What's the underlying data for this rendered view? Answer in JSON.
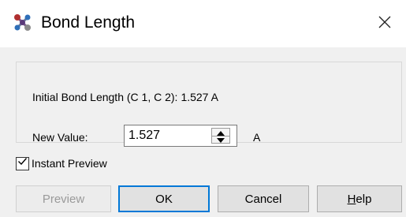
{
  "window": {
    "title": "Bond Length",
    "app_icon": "molecule-icon",
    "close_icon": "close-icon"
  },
  "info": {
    "label": "Initial Bond Length (C 1, C 2):",
    "value": "1.527 A"
  },
  "new_value": {
    "label": "New Value:",
    "value": "1.527",
    "unit": "A"
  },
  "instant_preview": {
    "label": "Instant Preview",
    "checked": true
  },
  "buttons": {
    "preview": "Preview",
    "ok": "OK",
    "cancel": "Cancel",
    "help_first": "H",
    "help_rest": "elp"
  },
  "colors": {
    "focus_border": "#0078d7",
    "dialog_bg": "#f0f0f0"
  }
}
